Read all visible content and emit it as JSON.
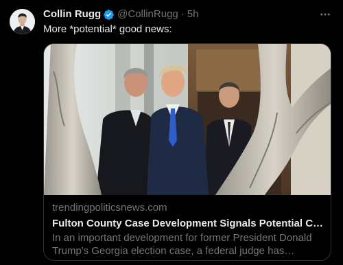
{
  "tweet": {
    "author": {
      "display_name": "Collin Rugg",
      "handle": "@CollinRugg",
      "verified": true,
      "avatar_icon": "person-avatar"
    },
    "separator": "·",
    "time": "5h",
    "text": "More *potential* good news:",
    "more_icon": "more-horizontal-icon",
    "link_card": {
      "domain": "trendingpoliticsnews.com",
      "title": "Fulton County Case Development Signals Potential Court Vi...",
      "description": "In an important development for former President Donald Trump's Georgia election case, a federal judge has schedule..."
    }
  },
  "colors": {
    "background": "#000000",
    "primary_text": "#e7e9ea",
    "secondary_text": "#71767b",
    "border": "#2f3336",
    "verified_badge": "#1d9bf0"
  }
}
